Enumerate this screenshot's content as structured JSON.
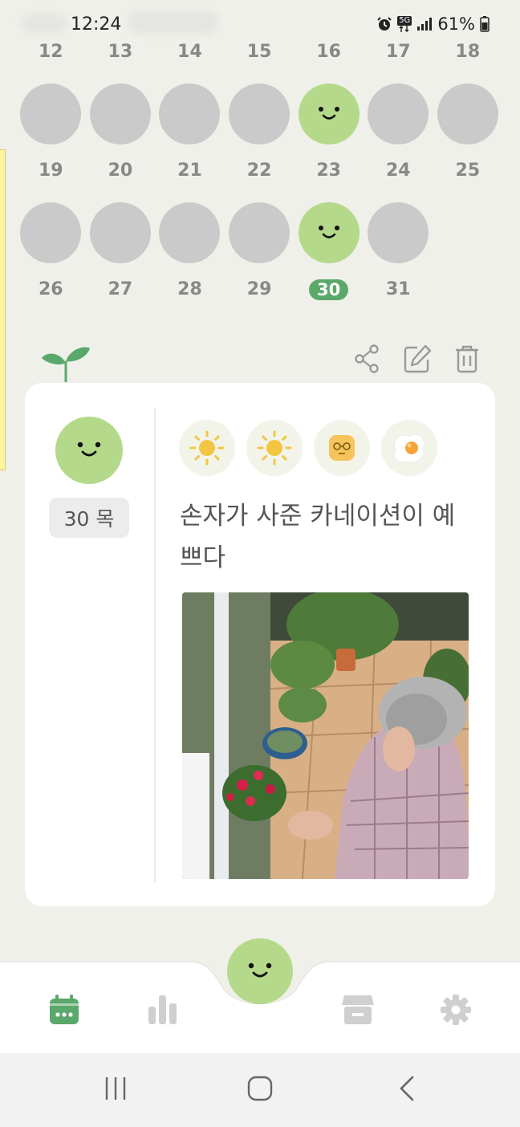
{
  "status": {
    "time": "12:24",
    "network": "5G",
    "battery": "61%"
  },
  "calendar": {
    "rows": [
      {
        "numbers": [
          "12",
          "13",
          "14",
          "15",
          "16",
          "17",
          "18"
        ]
      },
      {
        "numbers": [
          "19",
          "20",
          "21",
          "22",
          "23",
          "24",
          "25"
        ],
        "moods": [
          "none",
          "none",
          "none",
          "none",
          "smile",
          "none",
          "none"
        ]
      },
      {
        "numbers": [
          "26",
          "27",
          "28",
          "29",
          "30",
          "31"
        ],
        "moods": [
          "none",
          "none",
          "none",
          "none",
          "smile",
          "none"
        ]
      }
    ],
    "selected_day": "30"
  },
  "entry_actions": {
    "share_icon": "share-icon",
    "edit_icon": "edit-icon",
    "delete_icon": "trash-icon"
  },
  "entry": {
    "mood": "smile",
    "date_label": "30 목",
    "tag_icons": [
      "sun-icon",
      "sun-icon",
      "glasses-face-icon",
      "fried-egg-icon"
    ],
    "text": "손자가 사준 카네이션이 예쁘다",
    "photo_alt": "photo"
  },
  "bottom_nav": {
    "items": [
      "calendar-icon",
      "stats-icon",
      "store-icon",
      "settings-icon"
    ],
    "active": "calendar-icon",
    "accent": "#5aa86a"
  },
  "colors": {
    "mood_green": "#b5d98a",
    "empty_day": "#cacaca",
    "background": "#f0f0ea"
  }
}
